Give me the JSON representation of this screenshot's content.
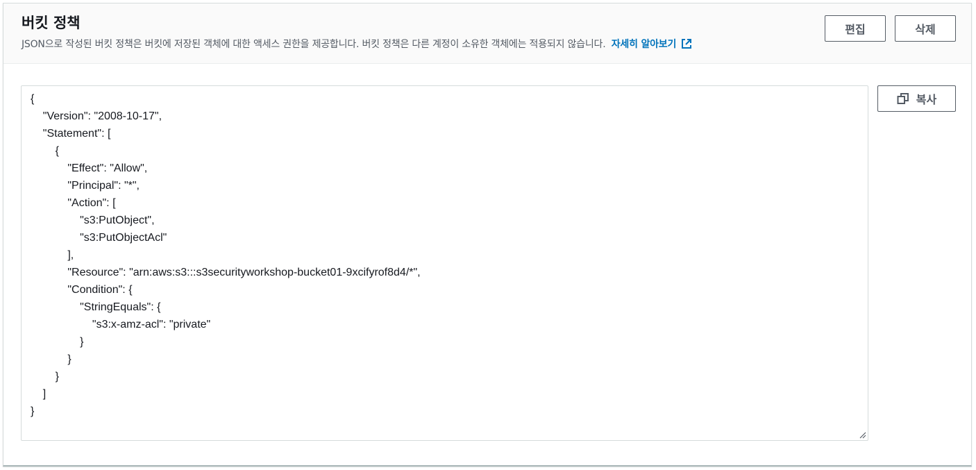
{
  "header": {
    "title": "버킷 정책",
    "description": "JSON으로 작성된 버킷 정책은 버킷에 저장된 객체에 대한 액세스 권한을 제공합니다. 버킷 정책은 다른 계정이 소유한 객체에는 적용되지 않습니다.",
    "learn_more": "자세히 알아보기"
  },
  "actions": {
    "edit_label": "편집",
    "delete_label": "삭제",
    "copy_label": "복사"
  },
  "policy_json": "{\n    \"Version\": \"2008-10-17\",\n    \"Statement\": [\n        {\n            \"Effect\": \"Allow\",\n            \"Principal\": \"*\",\n            \"Action\": [\n                \"s3:PutObject\",\n                \"s3:PutObjectAcl\"\n            ],\n            \"Resource\": \"arn:aws:s3:::s3securityworkshop-bucket01-9xcifyrof8d4/*\",\n            \"Condition\": {\n                \"StringEquals\": {\n                    \"s3:x-amz-acl\": \"private\"\n                }\n            }\n        }\n    ]\n}",
  "icons": {
    "external": "external-link-icon",
    "copy": "copy-icon",
    "resize": "resize-handle-icon"
  },
  "colors": {
    "link": "#0073bb",
    "text": "#16191f",
    "secondary_text": "#545b64",
    "header_bg": "#fafafa",
    "border": "#d5dbdb"
  }
}
